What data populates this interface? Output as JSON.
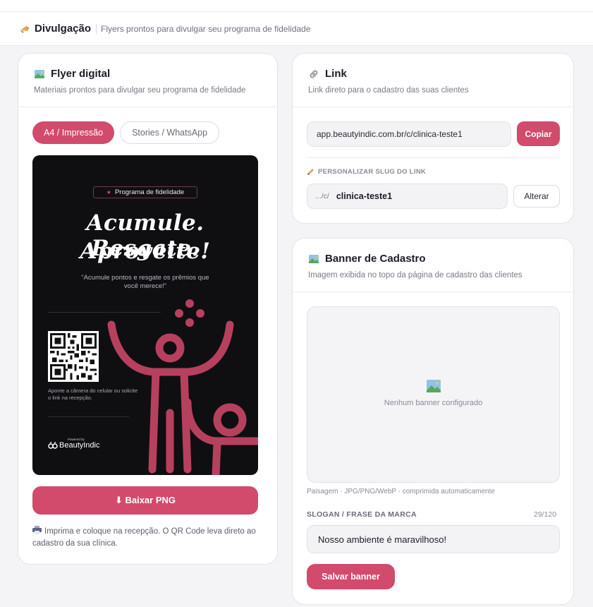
{
  "colors": {
    "accent": "#d24a6c",
    "flyer_bg": "#0f0f12",
    "page_bg": "#f4f4f6"
  },
  "header": {
    "icon": "megaphone-icon",
    "title": "Divulgação",
    "subtitle": "Flyers prontos para divulgar seu programa de fidelidade"
  },
  "flyer_card": {
    "icon": "picture-icon",
    "title": "Flyer digital",
    "subtitle": "Materiais prontos para divulgar seu programa de fidelidade",
    "tabs": [
      {
        "label": "A4 / Impressão",
        "active": true
      },
      {
        "label": "Stories / WhatsApp",
        "active": false
      }
    ],
    "flyer": {
      "badge": "Programa de fidelidade",
      "headline_line1": "Acumule. Resgate.",
      "headline_line2": "Aproveite!",
      "quote": "“Acumule pontos e resgate os prêmios que você merece!”",
      "scan_text": "Aponte a câmera do celular ou solicite o link na recepção.",
      "powered_by": "Powered by",
      "brand": "BeautyIndic"
    },
    "download_button": "⬇ Baixar PNG",
    "tip_icon": "printer-icon",
    "tip": "Imprima e coloque na recepção. O QR Code leva direto ao cadastro da sua clínica."
  },
  "link_card": {
    "icon": "link-icon",
    "title": "Link",
    "subtitle": "Link direto para o cadastro das suas clientes",
    "url": "app.beautyindic.com.br/c/clinica-teste1",
    "copy_button": "Copiar",
    "slug_label": "PERSONALIZAR SLUG DO LINK",
    "slug_prefix": ".../c/",
    "slug_value": "clinica-teste1",
    "alter_button": "Alterar"
  },
  "banner_card": {
    "icon": "picture-icon",
    "title": "Banner de Cadastro",
    "subtitle": "Imagem exibida no topo da página de cadastro das clientes",
    "empty_text": "Nenhum banner configurado",
    "hint": "Paisagem · JPG/PNG/WebP · comprimida automaticamente",
    "slogan_label": "SLOGAN / FRASE DA MARCA",
    "slogan_count": "29/120",
    "slogan_value": "Nosso ambiente é maravilhoso!",
    "save_button": "Salvar banner"
  }
}
